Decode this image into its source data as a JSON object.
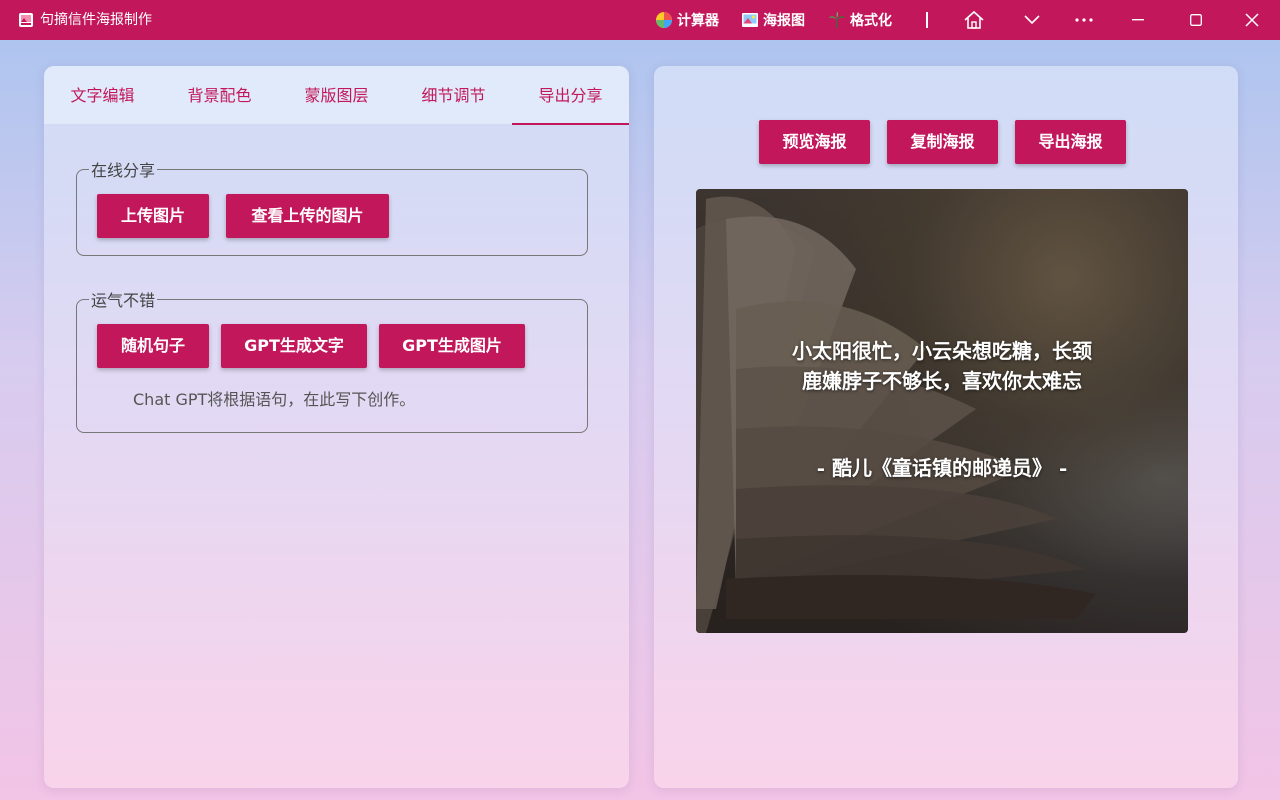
{
  "window": {
    "title": "句摘信件海报制作",
    "links": [
      {
        "label": "计算器",
        "icon": "calculator-icon"
      },
      {
        "label": "海报图",
        "icon": "poster-icon"
      },
      {
        "label": "格式化",
        "icon": "format-icon"
      }
    ],
    "separator": "|"
  },
  "tabs": [
    {
      "label": "文字编辑"
    },
    {
      "label": "背景配色"
    },
    {
      "label": "蒙版图层"
    },
    {
      "label": "细节调节"
    },
    {
      "label": "导出分享",
      "active": true
    }
  ],
  "share_group": {
    "legend": "在线分享",
    "upload_label": "上传图片",
    "view_uploaded_label": "查看上传的图片"
  },
  "luck_group": {
    "legend": "运气不错",
    "random_label": "随机句子",
    "gpt_text_label": "GPT生成文字",
    "gpt_image_label": "GPT生成图片",
    "hint": "Chat GPT将根据语句，在此写下创作。"
  },
  "actions": {
    "preview_label": "预览海报",
    "copy_label": "复制海报",
    "export_label": "导出海报"
  },
  "poster": {
    "quote_line1": "小太阳很忙，小云朵想吃糖，长颈",
    "quote_line2": "鹿嫌脖子不够长，喜欢你太难忘",
    "attribution": "- 酷儿《童话镇的邮递员》 -"
  },
  "colors": {
    "accent": "#c2185b",
    "titlebar": "#c2185b"
  }
}
